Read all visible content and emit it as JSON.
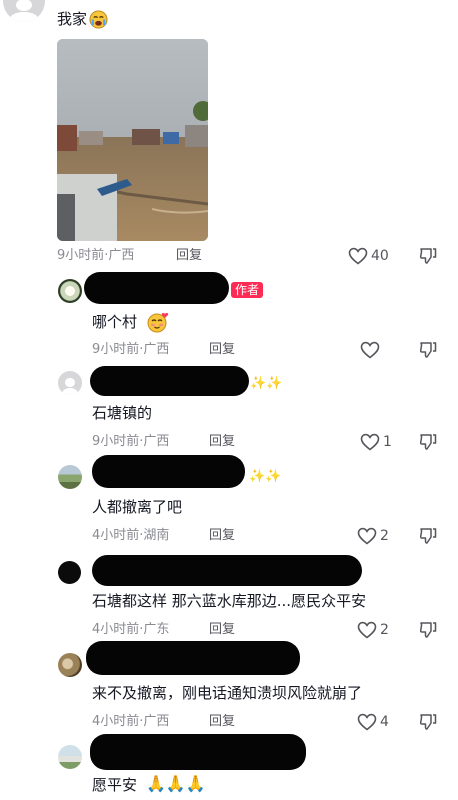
{
  "comments": [
    {
      "text": "我家",
      "time_location": "9小时前·广西",
      "reply": "回复",
      "likes": "40"
    },
    {
      "author_badge": "作者",
      "text": "哪个村",
      "time_location": "9小时前·广西",
      "reply": "回复",
      "likes": ""
    },
    {
      "text": "石塘镇的",
      "time_location": "9小时前·广西",
      "reply": "回复",
      "likes": "1"
    },
    {
      "text": "人都撤离了吧",
      "time_location": "4小时前·湖南",
      "reply": "回复",
      "likes": "2"
    },
    {
      "text": "石塘都这样  那六蓝水库那边...愿民众平安",
      "time_location": "4小时前·广东",
      "reply": "回复",
      "likes": "2"
    },
    {
      "text": "来不及撤离，刚电话通知溃坝风险就崩了",
      "time_location": "4小时前·广西",
      "reply": "回复",
      "likes": "4"
    },
    {
      "text": "愿平安"
    }
  ],
  "colors": {
    "badge": "#fe2c55",
    "meta": "#8a8b91",
    "redaction": "#050505"
  },
  "icons": [
    "heart-icon",
    "dislike-icon",
    "crying-emoji",
    "blushing-heart-emoji",
    "sparkle-emoji",
    "praying-hands-emoji"
  ]
}
